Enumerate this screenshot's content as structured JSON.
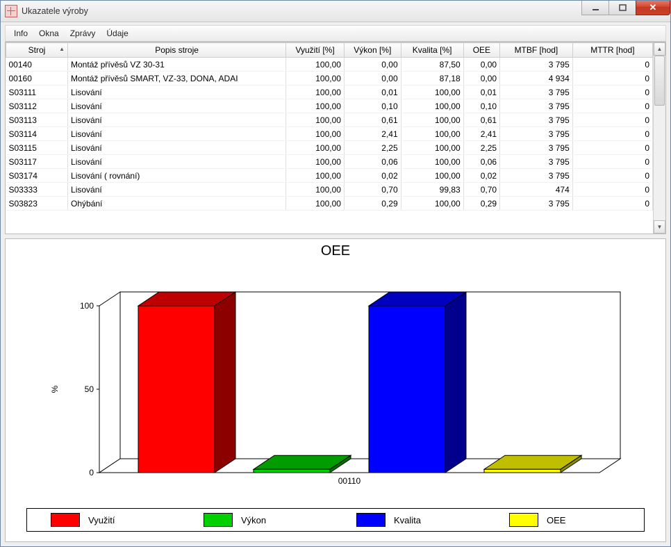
{
  "window": {
    "title": "Ukazatele výroby"
  },
  "menu": {
    "items": [
      "Info",
      "Okna",
      "Zprávy",
      "Údaje"
    ]
  },
  "table": {
    "headers": [
      "Stroj",
      "Popis stroje",
      "Využití [%]",
      "Výkon [%]",
      "Kvalita [%]",
      "OEE",
      "MTBF [hod]",
      "MTTR [hod]"
    ],
    "sort_col": 0,
    "rows": [
      {
        "stroj": "00140",
        "popis": "Montáž přívěsů VZ 30-31",
        "vyuziti": "100,00",
        "vykon": "0,00",
        "kvalita": "87,50",
        "oee": "0,00",
        "mtbf": "3 795",
        "mttr": "0"
      },
      {
        "stroj": "00160",
        "popis": "Montáž přívěsů SMART, VZ-33, DONA, ADAI",
        "vyuziti": "100,00",
        "vykon": "0,00",
        "kvalita": "87,18",
        "oee": "0,00",
        "mtbf": "4 934",
        "mttr": "0"
      },
      {
        "stroj": "S03111",
        "popis": "Lisování",
        "vyuziti": "100,00",
        "vykon": "0,01",
        "kvalita": "100,00",
        "oee": "0,01",
        "mtbf": "3 795",
        "mttr": "0"
      },
      {
        "stroj": "S03112",
        "popis": "Lisování",
        "vyuziti": "100,00",
        "vykon": "0,10",
        "kvalita": "100,00",
        "oee": "0,10",
        "mtbf": "3 795",
        "mttr": "0"
      },
      {
        "stroj": "S03113",
        "popis": "Lisování",
        "vyuziti": "100,00",
        "vykon": "0,61",
        "kvalita": "100,00",
        "oee": "0,61",
        "mtbf": "3 795",
        "mttr": "0"
      },
      {
        "stroj": "S03114",
        "popis": "Lisování",
        "vyuziti": "100,00",
        "vykon": "2,41",
        "kvalita": "100,00",
        "oee": "2,41",
        "mtbf": "3 795",
        "mttr": "0"
      },
      {
        "stroj": "S03115",
        "popis": "Lisování",
        "vyuziti": "100,00",
        "vykon": "2,25",
        "kvalita": "100,00",
        "oee": "2,25",
        "mtbf": "3 795",
        "mttr": "0"
      },
      {
        "stroj": "S03117",
        "popis": "Lisování",
        "vyuziti": "100,00",
        "vykon": "0,06",
        "kvalita": "100,00",
        "oee": "0,06",
        "mtbf": "3 795",
        "mttr": "0"
      },
      {
        "stroj": "S03174",
        "popis": "Lisování ( rovnání)",
        "vyuziti": "100,00",
        "vykon": "0,02",
        "kvalita": "100,00",
        "oee": "0,02",
        "mtbf": "3 795",
        "mttr": "0"
      },
      {
        "stroj": "S03333",
        "popis": "Lisování",
        "vyuziti": "100,00",
        "vykon": "0,70",
        "kvalita": "99,83",
        "oee": "0,70",
        "mtbf": "474",
        "mttr": "0"
      },
      {
        "stroj": "S03823",
        "popis": "Ohýbání",
        "vyuziti": "100,00",
        "vykon": "0,29",
        "kvalita": "100,00",
        "oee": "0,29",
        "mtbf": "3 795",
        "mttr": "0"
      }
    ]
  },
  "chart_data": {
    "type": "bar",
    "title": "OEE",
    "ylabel": "%",
    "ylim": [
      0,
      100
    ],
    "yticks": [
      0,
      50,
      100
    ],
    "categories": [
      "00110"
    ],
    "series": [
      {
        "name": "Využití",
        "color": "#ff0000",
        "values": [
          100
        ]
      },
      {
        "name": "Výkon",
        "color": "#00d000",
        "values": [
          2
        ]
      },
      {
        "name": "Kvalita",
        "color": "#0000ff",
        "values": [
          100
        ]
      },
      {
        "name": "OEE",
        "color": "#ffff00",
        "values": [
          2
        ]
      }
    ]
  }
}
